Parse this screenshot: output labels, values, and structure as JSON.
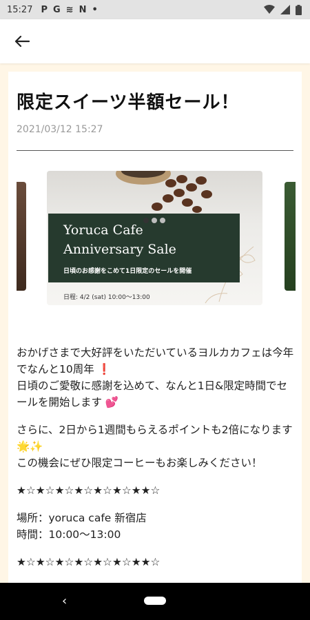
{
  "status_bar": {
    "time": "15:27",
    "left_icons": [
      "P",
      "G",
      "≋",
      "N",
      "•"
    ],
    "right_icons": [
      "wifi-icon",
      "signal-icon",
      "battery-icon"
    ]
  },
  "app_bar": {
    "back_icon": "arrow-left-icon"
  },
  "post": {
    "title": "限定スイーツ半額セール！",
    "date": "2021/03/12 15:27",
    "banner": {
      "title": "Yoruca Cafe\nAnniversary Sale",
      "subtitle": "日頃のお感謝をこめて1日限定のセールを開催",
      "date_line": "日程: 4/2 (sat) 10:00〜13:00"
    },
    "carousel": {
      "count": 3,
      "active_index": 0
    },
    "paragraphs": [
      "おかげさまで大好評をいただいているヨルカカフェは今年でなんと10周年 ❗\n日頃のご愛敬に感謝を込めて、なんと1日&限定時間でセールを開始します 💕",
      "さらに、2日から1週間もらえるポイントも2倍になります🌟✨\nこの機会にぜひ限定コーヒーもお楽しみください！"
    ],
    "stars_line": "★☆★☆★☆★☆★☆★☆★★☆",
    "place_line": "場所：yoruca cafe 新宿店",
    "time_line": "時間：10:00〜13:00",
    "stars_line_2": "★☆★☆★☆★☆★☆★☆★★☆"
  },
  "nav_bar": {
    "back_icon": "nav-back-icon",
    "home_icon": "nav-home-pill-icon"
  }
}
